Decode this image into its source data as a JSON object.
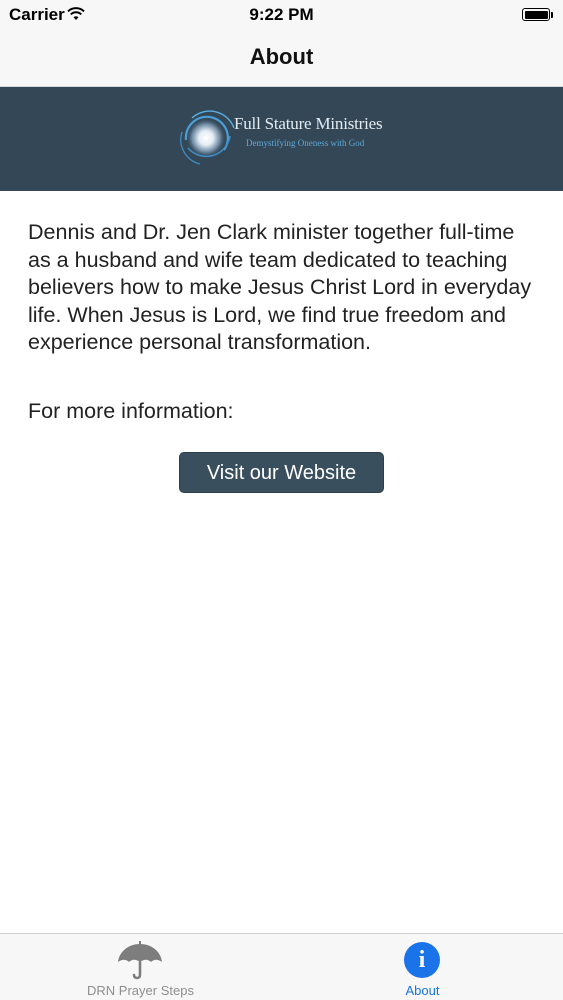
{
  "status_bar": {
    "carrier": "Carrier",
    "time": "9:22 PM",
    "wifi_icon": "wifi-icon",
    "battery_icon": "battery-icon"
  },
  "nav": {
    "title": "About"
  },
  "banner": {
    "logo_name": "Full Stature Ministries",
    "logo_tagline": "Demystifying Oneness with God",
    "background_color": "#334756"
  },
  "content": {
    "about_text": "Dennis and Dr. Jen Clark minister together full-time as a husband and wife team dedicated to teaching believers how to make Jesus Christ Lord in everyday life. When Jesus is Lord, we find true freedom and experience personal transformation.",
    "more_info_label": "For more information:",
    "website_button_label": "Visit our Website",
    "button_color": "#3a4f5e"
  },
  "tab_bar": {
    "tabs": [
      {
        "label": "DRN Prayer Steps",
        "icon": "umbrella-icon",
        "selected": false
      },
      {
        "label": "About",
        "icon": "info-icon",
        "selected": true
      }
    ],
    "active_color": "#1a73e8",
    "inactive_color": "#8e8e8e"
  }
}
